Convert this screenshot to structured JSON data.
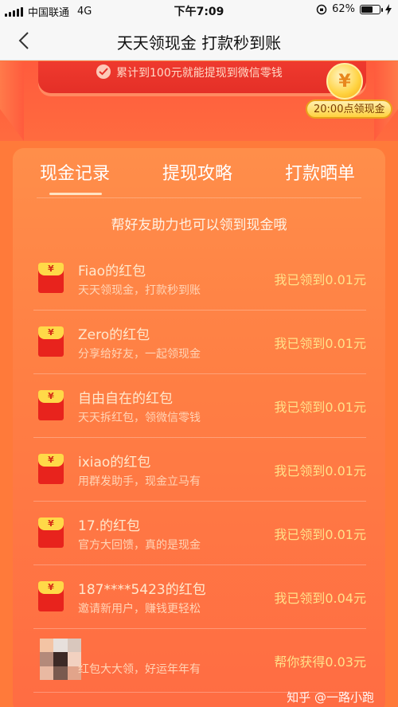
{
  "status_bar": {
    "carrier": "中国联通",
    "network": "4G",
    "time": "下午7:09",
    "battery": "62%"
  },
  "nav": {
    "title": "天天领现金 打款秒到账"
  },
  "banner": {
    "text": "累计到100元就能提现到微信零钱",
    "coin_symbol": "¥",
    "badge": "20:00点领现金"
  },
  "tabs": [
    {
      "label": "现金记录"
    },
    {
      "label": "提现攻略"
    },
    {
      "label": "打款晒单"
    }
  ],
  "hint": "帮好友助力也可以领到现金哦",
  "records": [
    {
      "title": "Fiao的红包",
      "subtitle": "天天领现金，打款秒到账",
      "amount": "我已领到0.01元"
    },
    {
      "title": "Zero的红包",
      "subtitle": "分享给好友，一起领现金",
      "amount": "我已领到0.01元"
    },
    {
      "title": "自由自在的红包",
      "subtitle": "天天拆红包，领微信零钱",
      "amount": "我已领到0.01元"
    },
    {
      "title": "ixiao的红包",
      "subtitle": "用群发助手，现金立马有",
      "amount": "我已领到0.01元"
    },
    {
      "title": "17.的红包",
      "subtitle": "官方大回馈，真的是现金",
      "amount": "我已领到0.01元"
    },
    {
      "title": "187****5423的红包",
      "subtitle": "邀请新用户，赚钱更轻松",
      "amount": "我已领到0.04元"
    },
    {
      "title": "",
      "subtitle": "红包大大领，好运年年有",
      "amount": "帮你获得0.03元"
    }
  ],
  "envelope_symbol": "¥",
  "watermark": "知乎 @一路小跑",
  "colors": {
    "accent": "#ff7a3a",
    "amount": "#ffe18a"
  }
}
